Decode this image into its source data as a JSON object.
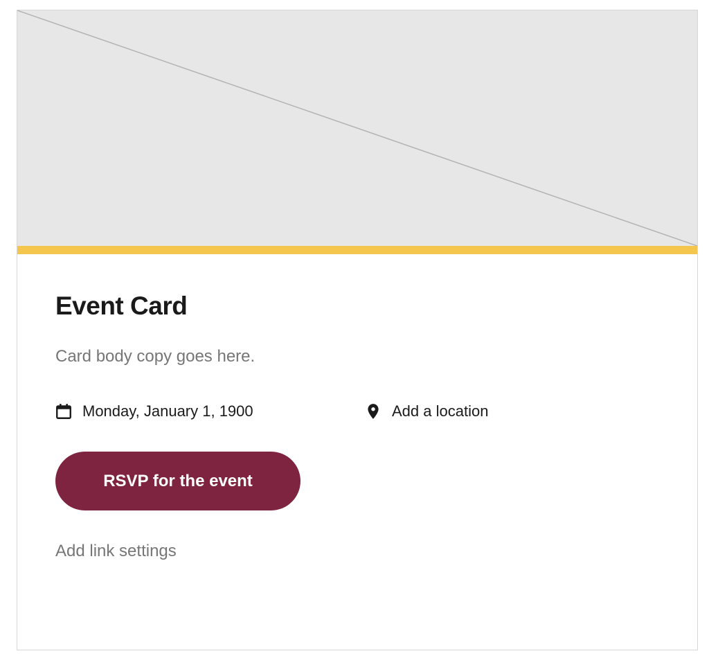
{
  "card": {
    "title": "Event Card",
    "body": "Card body copy goes here.",
    "date": "Monday, January 1, 1900",
    "location": "Add a location",
    "rsvp_label": "RSVP for the event",
    "link_settings_label": "Add link settings"
  },
  "icons": {
    "image": "image-placeholder-icon",
    "date": "calendar-icon",
    "location": "map-pin-icon"
  },
  "colors": {
    "accent_bar": "#f4c64e",
    "button_background": "#7e2440",
    "image_background": "#e7e7e7"
  }
}
